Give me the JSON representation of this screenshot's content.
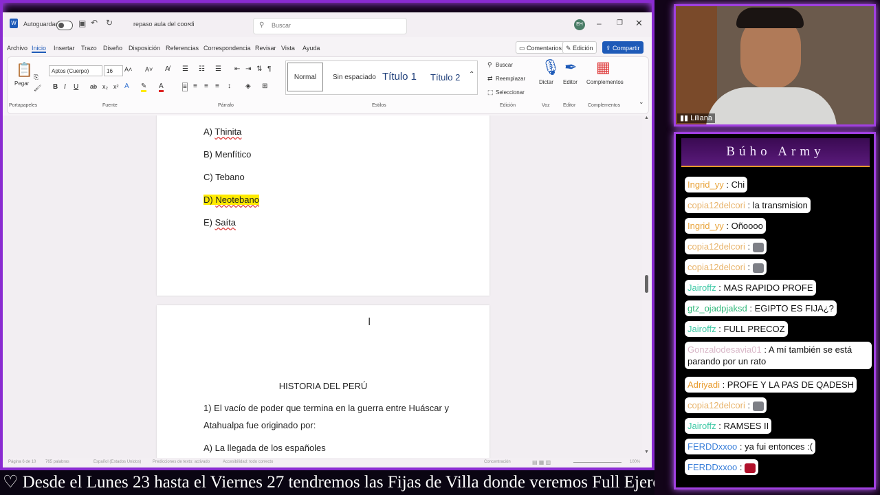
{
  "word": {
    "autosave_label": "Autoguardado",
    "doc_title": "repaso aula del coordi",
    "search_placeholder": "Buscar",
    "user_initials": "EH",
    "menu": [
      "Archivo",
      "Inicio",
      "Insertar",
      "Trazo",
      "Diseño",
      "Disposición",
      "Referencias",
      "Correspondencia",
      "Revisar",
      "Vista",
      "Ayuda"
    ],
    "comments_label": "Comentarios",
    "edit_label": "Edición",
    "share_label": "Compartir",
    "paste_label": "Pegar",
    "font_name": "Aptos (Cuerpo)",
    "font_size": "16",
    "styles": [
      "Normal",
      "Sin espaciado",
      "Título 1",
      "Título 2"
    ],
    "find_label": "Buscar",
    "replace_label": "Reemplazar",
    "select_label": "Seleccionar",
    "dictate_label": "Dictar",
    "editor_label": "Editor",
    "addins_label": "Complementos",
    "groups": [
      "Portapapeles",
      "Fuente",
      "Párrafo",
      "Estilos",
      "Edición",
      "Voz",
      "Editor",
      "Complementos"
    ],
    "page1_options": [
      {
        "prefix": "A) ",
        "text": "Thinita"
      },
      {
        "prefix": "B) ",
        "text": "Menfítico"
      },
      {
        "prefix": "C) ",
        "text": "Tebano"
      },
      {
        "prefix": "D) ",
        "text": "Neotebano"
      },
      {
        "prefix": "E) ",
        "text": "Saíta"
      }
    ],
    "page2_heading": "HISTORIA DEL PERÚ",
    "page2_q1_line1": "1) El vacío de poder que termina en la guerra entre Huáscar y",
    "page2_q1_line2": "Atahualpa fue originado por:",
    "page2_optA": "A) La llegada de los españoles",
    "status": {
      "page": "Página 6 de 10",
      "words": "765 palabras",
      "language": "Español (Estados Unidos)",
      "predictions": "Predicciones de texto: activado",
      "accessibility": "Accesibilidad: todo correcto",
      "focus": "Concentración",
      "zoom": "100%"
    }
  },
  "cam": {
    "name": "Liliana"
  },
  "chat": {
    "title": "Búho Army",
    "messages": [
      {
        "user": "Ingrid_yy",
        "color": "#e8a33a",
        "text": ": Chi"
      },
      {
        "user": "copia12delcori",
        "color": "#e8b36a",
        "text": ": la transmision"
      },
      {
        "user": "Ingrid_yy",
        "color": "#e8a33a",
        "text": ": Oñoooo"
      },
      {
        "user": "copia12delcori",
        "color": "#e8b36a",
        "text": ": ",
        "emote": "cat-emote"
      },
      {
        "user": "copia12delcori",
        "color": "#e8b36a",
        "text": ": ",
        "emote": "cat-emote"
      },
      {
        "user": "Jairoffz",
        "color": "#3fc9a6",
        "text": ": MAS RAPIDO PROFE"
      },
      {
        "user": "gtz_ojadpjaksd",
        "color": "#2fb87a",
        "text": ": EGIPTO ES FIJA¿?"
      },
      {
        "user": "Jairoffz",
        "color": "#3fc9a6",
        "text": ": FULL PRECOZ"
      },
      {
        "user": "Gonzalodesavia01",
        "color": "#d9b8c8",
        "text": ": A mí también se está parando por un rato"
      },
      {
        "user": "Adriyadi",
        "color": "#e89a2a",
        "text": ": PROFE Y LA PAS DE QADESH"
      },
      {
        "user": "copia12delcori",
        "color": "#e8b36a",
        "text": ": ",
        "emote": "cat-emote"
      },
      {
        "user": "Jairoffz",
        "color": "#3fc9a6",
        "text": ": RAMSES II"
      },
      {
        "user": "FERDDxxoo",
        "color": "#3a7fd9",
        "text": ": ya fui entonces :("
      },
      {
        "user": "FERDDxxoo",
        "color": "#3a7fd9",
        "text": ": ",
        "emote": "red-emote"
      }
    ]
  },
  "ticker": {
    "icon": "heart-icon",
    "text": "♡   Desde el Lunes 23 hasta el Viernes 27 tendremos las Fijas de Villa donde veremos Full Ejercicios"
  }
}
